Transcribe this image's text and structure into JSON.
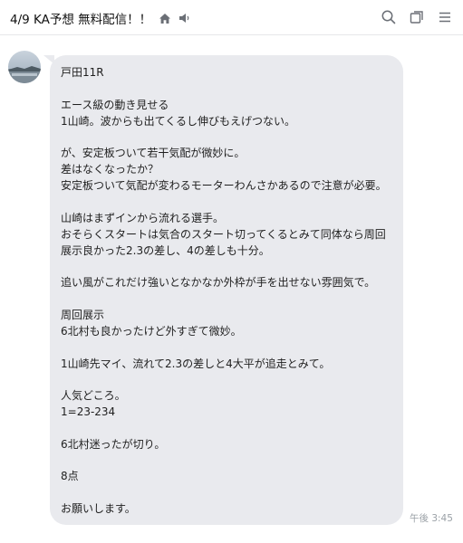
{
  "header": {
    "title": "4/9 KA予想 無料配信！！",
    "icons": [
      "home-icon",
      "speaker-icon"
    ],
    "actions": [
      "search-icon",
      "window-icon",
      "menu-icon"
    ]
  },
  "message": {
    "lines": [
      "戸田11R",
      "",
      "エース級の動き見せる",
      "1山崎。波からも出てくるし伸びもえげつない。",
      "",
      "が、安定板ついて若干気配が微妙に。",
      "差はなくなったか？",
      "安定板ついて気配が変わるモーターわんさかあるので注意が必要。",
      "",
      "山崎はまずインから流れる選手。",
      "おそらくスタートは気合のスタート切ってくるとみて同体なら周回",
      "展示良かった2.3の差し、4の差しも十分。",
      "",
      "追い風がこれだけ強いとなかなか外枠が手を出せない雰囲気で。",
      "",
      "周回展示",
      "6北村も良かったけど外すぎて微妙。",
      "",
      "1山崎先マイ、流れて2.3の差しと4大平が追走とみて。",
      "",
      "人気どころ。",
      "1=23-234",
      "",
      "6北村迷ったが切り。",
      "",
      "8点",
      "",
      "お願いします。"
    ],
    "timestamp": "午後 3:45"
  },
  "colors": {
    "bubble": "#e9eaee",
    "header_border": "#e6e7ea",
    "timestamp": "#9aa0a6"
  }
}
